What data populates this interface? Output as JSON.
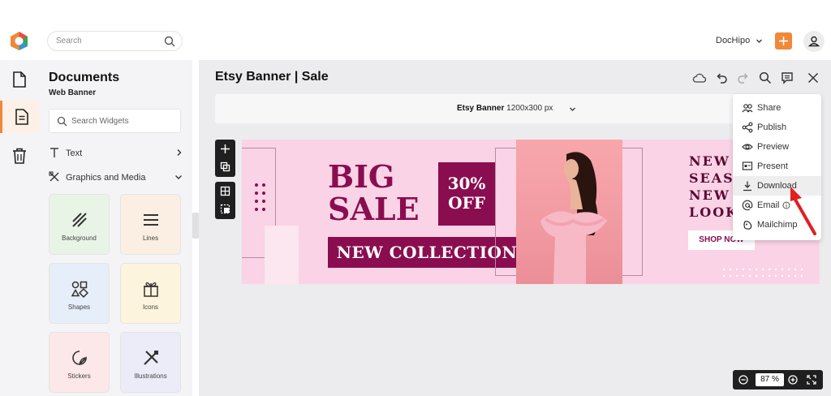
{
  "header": {
    "search_placeholder": "Search",
    "brand": "DocHipo"
  },
  "rail": {
    "items": [
      "file-icon",
      "document-icon",
      "trash-icon"
    ],
    "active_index": 1
  },
  "panel": {
    "title": "Documents",
    "subtitle": "Web Banner",
    "widget_search_placeholder": "Search Widgets",
    "rows": [
      {
        "label": "Text"
      },
      {
        "label": "Graphics and Media"
      }
    ],
    "tiles": [
      {
        "label": "Background",
        "bg": "#e8f5e6"
      },
      {
        "label": "Lines",
        "bg": "#fbeee3"
      },
      {
        "label": "Shapes",
        "bg": "#e6eef9"
      },
      {
        "label": "Icons",
        "bg": "#fdf4de"
      },
      {
        "label": "Stickers",
        "bg": "#fce8e8"
      },
      {
        "label": "Illustrations",
        "bg": "#ecebf8"
      }
    ]
  },
  "editor": {
    "doc_title": "Etsy Banner | Sale",
    "size_name": "Etsy Banner",
    "size_dims": "1200x300 px"
  },
  "banner": {
    "big_line1": "BIG",
    "big_line2": "SALE",
    "pct_line1": "30%",
    "pct_line2": "OFF",
    "collection": "NEW COLLECTION",
    "new_season": "NEW\nSEASO\nNEW\nLOOK",
    "shop": "SHOP NOW",
    "accent": "#8a0d50",
    "background": "#fad3e6"
  },
  "menu": {
    "items": [
      {
        "label": "Share",
        "icon": "share-users-icon"
      },
      {
        "label": "Publish",
        "icon": "publish-icon"
      },
      {
        "label": "Preview",
        "icon": "eye-icon"
      },
      {
        "label": "Present",
        "icon": "present-icon"
      },
      {
        "label": "Download",
        "icon": "download-icon"
      },
      {
        "label": "Email",
        "icon": "at-icon"
      },
      {
        "label": "Mailchimp",
        "icon": "mailchimp-icon"
      }
    ],
    "highlighted": "Download"
  },
  "zoom": {
    "value": "87",
    "unit": "%"
  },
  "colors": {
    "brand_orange": "#f0883a",
    "arrow_red": "#e02020"
  }
}
